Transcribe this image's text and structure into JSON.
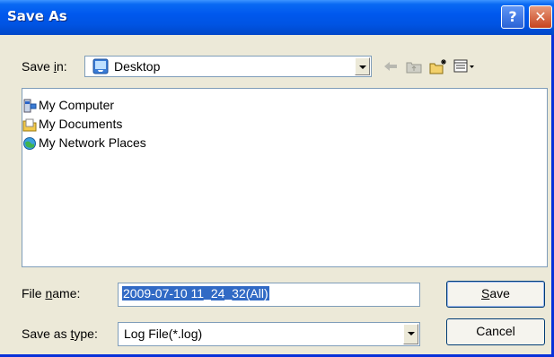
{
  "title": "Save As",
  "save_in": {
    "label_pre": "Save ",
    "label_u": "i",
    "label_post": "n:",
    "value": "Desktop"
  },
  "items": [
    {
      "label": "My Computer",
      "icon": "computer-icon"
    },
    {
      "label": "My Documents",
      "icon": "documents-folder-icon"
    },
    {
      "label": "My Network Places",
      "icon": "network-places-icon"
    }
  ],
  "filename": {
    "label_pre": "File ",
    "label_u": "n",
    "label_post": "ame:",
    "value": "2009-07-10 11_24_32(All)"
  },
  "savetype": {
    "label_pre": "Save as ",
    "label_u": "t",
    "label_post": "ype:",
    "value": "Log File(*.log)"
  },
  "buttons": {
    "save_u": "S",
    "save_rest": "ave",
    "cancel": "Cancel"
  },
  "title_buttons": {
    "help": "?",
    "close": "✕"
  },
  "colors": {
    "title_bar": "#0054e3",
    "face": "#ece9d8",
    "selection": "#316ac5"
  }
}
